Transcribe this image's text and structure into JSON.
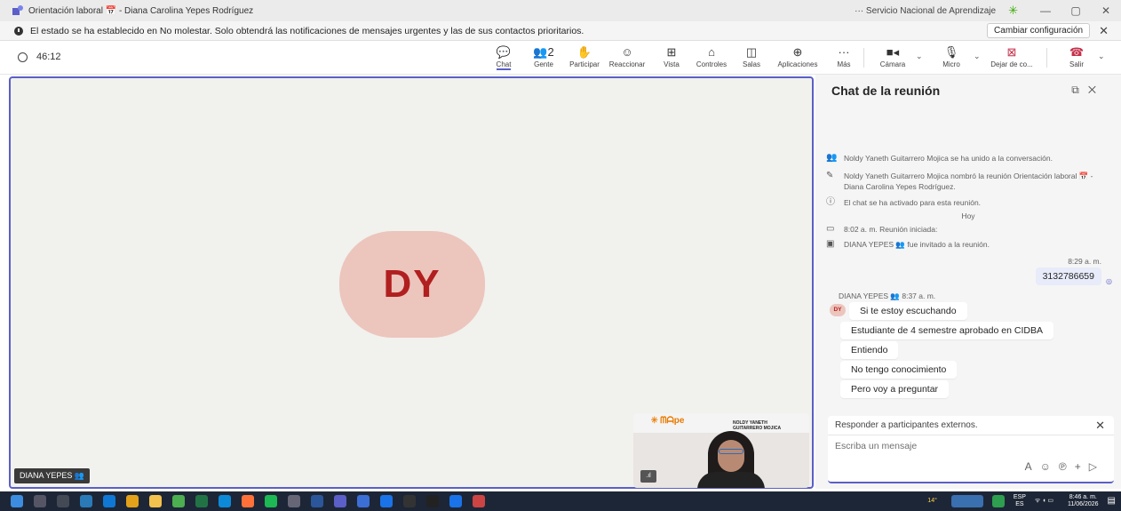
{
  "titlebar": {
    "title": "Orientación laboral 📅 - Diana Carolina Yepes Rodríguez",
    "org": "··· Servicio Nacional de Aprendizaje",
    "minimize": "—",
    "restore": "▢",
    "close": "✕"
  },
  "notice": {
    "text": "El estado se ha establecido en No molestar. Solo obtendrá las notificaciones de mensajes urgentes y las de sus contactos prioritarios.",
    "action": "Cambiar configuración",
    "close": "✕"
  },
  "meeting": {
    "timer": "46:12",
    "toolbar": [
      {
        "label": "Chat",
        "icon": "💬"
      },
      {
        "label": "Gente",
        "icon": "👥2"
      },
      {
        "label": "Participar",
        "icon": "✋"
      },
      {
        "label": "Reaccionar",
        "icon": "☺"
      },
      {
        "label": "Vista",
        "icon": "⊞"
      },
      {
        "label": "Controles",
        "icon": "⌂"
      },
      {
        "label": "Salas",
        "icon": "◫"
      },
      {
        "label": "Aplicaciones",
        "icon": "⊕"
      },
      {
        "label": "Más",
        "icon": "···"
      },
      {
        "label": "Cámara",
        "icon": "■◂"
      },
      {
        "label": "Micro",
        "icon": "🎙"
      },
      {
        "label": "Dejar de co...",
        "icon": "⊠"
      },
      {
        "label": "Salir",
        "icon": "☎"
      }
    ]
  },
  "stage": {
    "initials": "DY",
    "name_chip": "DIANA YEPES",
    "tile": {
      "brand": "✳ ᗰᗩpe",
      "name_line1": "NOLDY YANETH",
      "name_line2": "GUITARRERO MOJICA",
      "signal": ".ıl"
    }
  },
  "chat": {
    "title": "Chat de la reunión",
    "events": [
      {
        "icon": "👥",
        "text": "Noldy Yaneth Guitarrero Mojica se ha unido a la conversación."
      },
      {
        "icon": "✎",
        "text": "Noldy Yaneth Guitarrero Mojica nombró la reunión Orientación laboral 📅 - Diana Carolina Yepes Rodríguez."
      },
      {
        "icon": "ⓘ",
        "text": "El chat se ha activado para esta reunión."
      }
    ],
    "day": "Hoy",
    "events2": [
      {
        "icon": "▭",
        "text": "8:02 a. m.   Reunión iniciada:"
      },
      {
        "icon": "▣",
        "text": "DIANA YEPES 👥 fue invitado a la reunión."
      }
    ],
    "my_time": "8:29 a. m.",
    "my_message": "3132786659",
    "sender": "DIANA YEPES 👥  8:37 a. m.",
    "sender_initials": "DY",
    "messages": [
      "Si te estoy escuchando",
      "Estudiante de 4 semestre aprobado en CIDBA",
      "Entiendo",
      "No tengo conocimiento",
      "Pero voy a preguntar"
    ],
    "external_note": "Responder a participantes externos.",
    "placeholder": "Escriba un mensaje"
  },
  "taskbar": {
    "weather": "14°",
    "lang1": "ESP",
    "lang2": "ES",
    "time": "8:46 a. m.",
    "date": "11/06/2026"
  }
}
